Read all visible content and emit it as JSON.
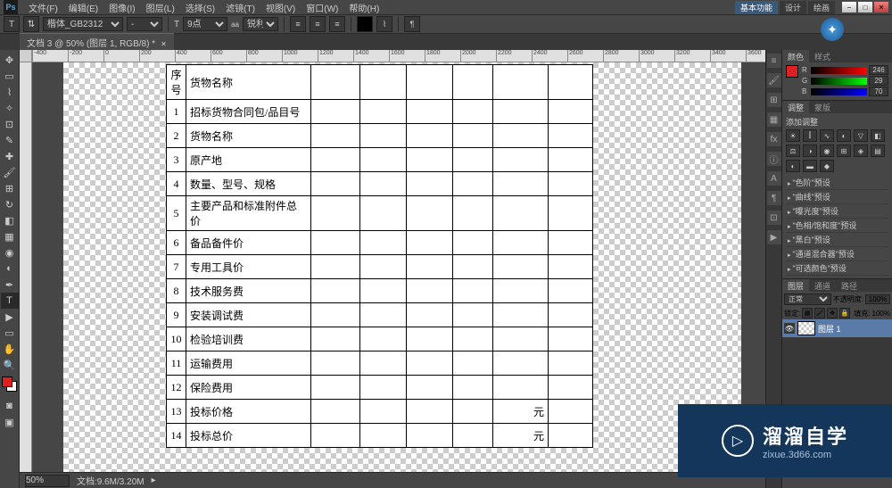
{
  "app": {
    "logo": "Ps"
  },
  "menu": {
    "items": [
      "文件(F)",
      "编辑(E)",
      "图像(I)",
      "图层(L)",
      "选择(S)",
      "滤镜(T)",
      "视图(V)",
      "窗口(W)",
      "帮助(H)"
    ],
    "workspace_active": "基本功能",
    "workspace_tabs": [
      "设计",
      "绘画"
    ]
  },
  "options": {
    "font_family": "楷体_GB2312",
    "font_style": "-",
    "font_size": "9点",
    "aa": "锐利"
  },
  "doc_tab": {
    "title": "文档 3 @ 50% (图层 1, RGB/8) *"
  },
  "ruler_ticks_h": [
    "-400",
    "-200",
    "0",
    "200",
    "400",
    "600",
    "800",
    "1000",
    "1200",
    "1400",
    "1600",
    "1800",
    "2000",
    "2200",
    "2400",
    "2600",
    "2800",
    "3000",
    "3200",
    "3400",
    "3600"
  ],
  "table": {
    "header": [
      "序号",
      "货物名称"
    ],
    "rows": [
      {
        "idx": "1",
        "name": "招标货物合同包/品目号"
      },
      {
        "idx": "2",
        "name": "货物名称"
      },
      {
        "idx": "3",
        "name": "原产地"
      },
      {
        "idx": "4",
        "name": "数量、型号、规格"
      },
      {
        "idx": "5",
        "name": "主要产品和标准附件总价",
        "tall": true
      },
      {
        "idx": "6",
        "name": "备品备件价"
      },
      {
        "idx": "7",
        "name": "专用工具价"
      },
      {
        "idx": "8",
        "name": "技术服务费"
      },
      {
        "idx": "9",
        "name": "安装调试费"
      },
      {
        "idx": "10",
        "name": "检验培训费"
      },
      {
        "idx": "11",
        "name": "运输费用"
      },
      {
        "idx": "12",
        "name": "保险费用"
      },
      {
        "idx": "13",
        "name": "投标价格",
        "unit": "元"
      },
      {
        "idx": "14",
        "name": "投标总价",
        "unit": "元"
      }
    ]
  },
  "status": {
    "zoom": "50%",
    "doc_info": "文档:9.6M/3.20M"
  },
  "panels": {
    "color": {
      "tabs": [
        "颜色",
        "样式"
      ],
      "r": "246",
      "g": "29",
      "b": "70"
    },
    "adjustments": {
      "tabs": [
        "调整",
        "蒙版"
      ],
      "title": "添加调整",
      "presets": [
        "\"色阶\"预设",
        "\"曲线\"预设",
        "\"曝光度\"预设",
        "\"色相/饱和度\"预设",
        "\"黑白\"预设",
        "\"通道混合器\"预设",
        "\"可选颜色\"预设"
      ]
    },
    "layers": {
      "tabs": [
        "图层",
        "通道",
        "路径"
      ],
      "blend_mode": "正常",
      "opacity_label": "不透明度:",
      "opacity": "100%",
      "fill_label": "填充:",
      "fill": "100%",
      "lock_label": "锁定:",
      "layer_name": "图层 1"
    }
  },
  "watermark": {
    "title": "溜溜自学",
    "url": "zixue.3d66.com"
  }
}
